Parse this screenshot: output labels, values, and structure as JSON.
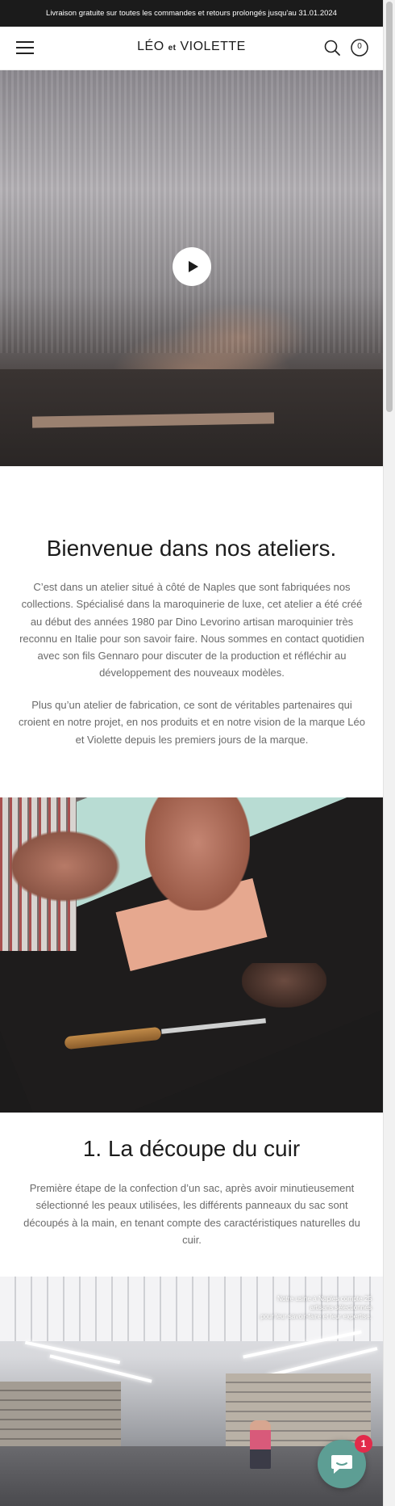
{
  "announcement": "Livraison gratuite sur toutes les commandes et retours prolongés jusqu'au 31.01.2024",
  "header": {
    "logo_main": "LÉO",
    "logo_et": "et",
    "logo_second": "VIOLETTE",
    "cart_count": "0",
    "menu_icon": "hamburger-menu-icon",
    "search_icon": "search-icon",
    "cart_icon": "cart-bag-icon"
  },
  "hero": {
    "play_icon": "play-icon"
  },
  "intro": {
    "title": "Bienvenue dans nos ateliers.",
    "paragraph1": "C’est dans un atelier situé à côté de Naples que sont fabriquées nos collections. Spécialisé dans la maroquinerie de luxe, cet atelier a été créé au début des années 1980 par Dino Levorino artisan maroquinier très reconnu en Italie pour son savoir faire. Nous sommes en contact quotidien avec son fils Gennaro pour discuter de la production et réfléchir au développement des nouveaux modèles.",
    "paragraph2": "Plus qu’un atelier de fabrication, ce sont de véritables partenaires qui croient en notre projet, en nos produits et en notre vision de la marque Léo et Violette depuis les premiers jours de la marque."
  },
  "section1": {
    "title": "1. La découpe du cuir",
    "paragraph": "Première étape de la confection d’un sac, après avoir minutieusement sélectionné les peaux utilisées, les différents panneaux du sac sont découpés à la main, en tenant compte des caractéristiques naturelles du cuir."
  },
  "factory_image": {
    "caption_line1": "Notre usine à Naples compte 25",
    "caption_line2": "artisans sélectionnés",
    "caption_line3": "pour leur savoir-faire et leur expertise."
  },
  "chat": {
    "badge_count": "1",
    "icon": "chat-bubble-icon"
  },
  "colors": {
    "announcement_bg": "#1b1b1b",
    "chat_button": "#5d9e94",
    "badge": "#e22b4a",
    "body_text": "#6a6a6a"
  }
}
